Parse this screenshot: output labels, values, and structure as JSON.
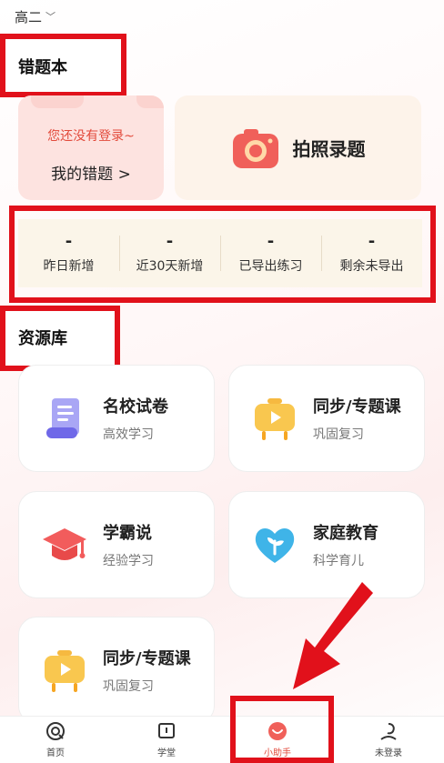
{
  "header": {
    "grade": "高二"
  },
  "wrong_book": {
    "title": "错题本",
    "login_hint": "您还没有登录~",
    "my_wrong_label": "我的错题 >",
    "photo_label": "拍照录题",
    "stats": [
      {
        "value": "-",
        "label": "昨日新增"
      },
      {
        "value": "-",
        "label": "近30天新增"
      },
      {
        "value": "-",
        "label": "已导出练习"
      },
      {
        "value": "-",
        "label": "剩余未导出"
      }
    ]
  },
  "resources": {
    "title": "资源库",
    "cards": [
      {
        "title": "名校试卷",
        "subtitle": "高效学习",
        "icon": "scroll-icon"
      },
      {
        "title": "同步/专题课",
        "subtitle": "巩固复习",
        "icon": "video-board-icon"
      },
      {
        "title": "学霸说",
        "subtitle": "经验学习",
        "icon": "graduation-cap-icon"
      },
      {
        "title": "家庭教育",
        "subtitle": "科学育儿",
        "icon": "heart-sprout-icon"
      },
      {
        "title": "同步/专题课",
        "subtitle": "巩固复习",
        "icon": "video-board-icon"
      }
    ]
  },
  "nav": {
    "items": [
      {
        "label": "首页",
        "icon": "home-icon"
      },
      {
        "label": "学堂",
        "icon": "book-icon"
      },
      {
        "label": "小助手",
        "icon": "assistant-icon",
        "active": true
      },
      {
        "label": "未登录",
        "icon": "user-icon"
      }
    ]
  },
  "colors": {
    "highlight": "#e1111b",
    "accent": "#e24a3b"
  }
}
